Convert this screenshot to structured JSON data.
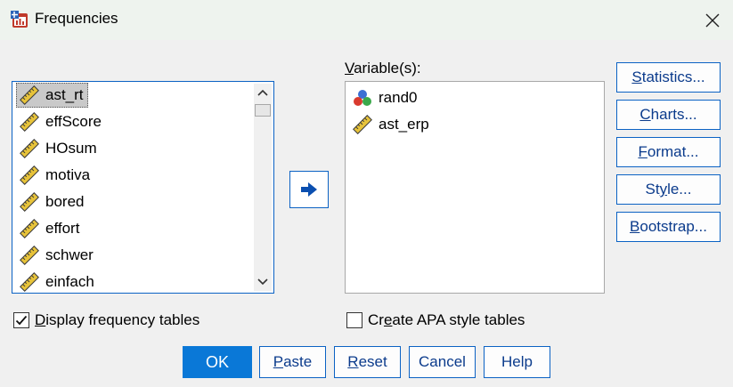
{
  "window": {
    "title": "Frequencies"
  },
  "source": {
    "items": [
      {
        "label": "ast_rt",
        "selected": true
      },
      {
        "label": "effScore"
      },
      {
        "label": "HOsum"
      },
      {
        "label": "motiva"
      },
      {
        "label": "bored"
      },
      {
        "label": "effort"
      },
      {
        "label": "schwer"
      },
      {
        "label": "einfach"
      }
    ]
  },
  "target": {
    "label_first": "V",
    "label_rest": "ariable(s):",
    "items": [
      {
        "label": "rand0",
        "icon": "nominal-variable-icon"
      },
      {
        "label": "ast_erp",
        "icon": "scale-variable-icon"
      }
    ]
  },
  "side_buttons": [
    {
      "mn": "S",
      "rest": "tatistics..."
    },
    {
      "mn": "C",
      "rest": "harts..."
    },
    {
      "mn": "F",
      "rest": "ormat..."
    },
    {
      "mn": "",
      "pre": "St",
      "mid": "y",
      "rest": "le..."
    },
    {
      "mn": "B",
      "rest": "ootstrap..."
    }
  ],
  "checkboxes": {
    "display_freq": {
      "mn": "D",
      "rest": "isplay frequency tables",
      "checked": true
    },
    "apa": {
      "pre": "Cr",
      "mn": "e",
      "rest": "ate APA style tables",
      "checked": false
    }
  },
  "bottom_buttons": {
    "ok": "OK",
    "paste": {
      "mn": "P",
      "rest": "aste"
    },
    "reset": {
      "mn": "R",
      "rest": "eset"
    },
    "cancel": "Cancel",
    "help": "Help"
  },
  "colors": {
    "accent": "#0b62c4",
    "ok": "#0a78d7",
    "selection": "#c9c9c9"
  }
}
